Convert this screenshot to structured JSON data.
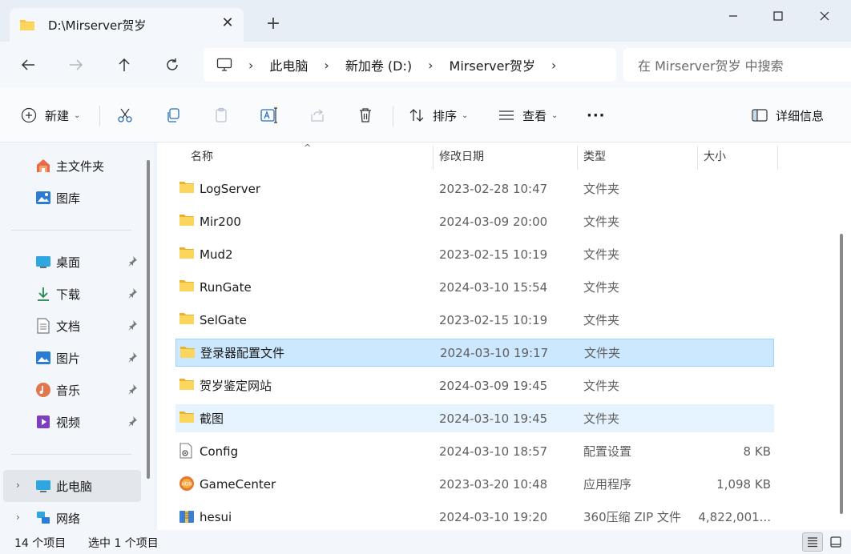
{
  "tab": {
    "title": "D:\\Mirserver贺岁"
  },
  "address": {
    "crumbs": [
      "此电脑",
      "新加卷 (D:)",
      "Mirserver贺岁"
    ],
    "search_placeholder": "在 Mirserver贺岁 中搜索"
  },
  "toolbar": {
    "new_label": "新建",
    "sort_label": "排序",
    "view_label": "查看",
    "more_label": "···",
    "details_label": "详细信息"
  },
  "sidebar": {
    "top": [
      {
        "label": "主文件夹",
        "icon": "home-icon"
      },
      {
        "label": "图库",
        "icon": "gallery-icon"
      }
    ],
    "pinned": [
      {
        "label": "桌面",
        "icon": "desktop-icon"
      },
      {
        "label": "下载",
        "icon": "download-icon"
      },
      {
        "label": "文档",
        "icon": "document-icon"
      },
      {
        "label": "图片",
        "icon": "picture-icon"
      },
      {
        "label": "音乐",
        "icon": "music-icon"
      },
      {
        "label": "视频",
        "icon": "video-icon"
      }
    ],
    "bottom": [
      {
        "label": "此电脑",
        "icon": "pc-icon"
      },
      {
        "label": "网络",
        "icon": "network-icon"
      }
    ]
  },
  "columns": {
    "name": "名称",
    "date": "修改日期",
    "type": "类型",
    "size": "大小"
  },
  "files": [
    {
      "name": "LogServer",
      "date": "2023-02-28 10:47",
      "type": "文件夹",
      "size": "",
      "icon": "folder-icon"
    },
    {
      "name": "Mir200",
      "date": "2024-03-09 20:00",
      "type": "文件夹",
      "size": "",
      "icon": "folder-icon"
    },
    {
      "name": "Mud2",
      "date": "2023-02-15 10:19",
      "type": "文件夹",
      "size": "",
      "icon": "folder-icon"
    },
    {
      "name": "RunGate",
      "date": "2024-03-10 15:54",
      "type": "文件夹",
      "size": "",
      "icon": "folder-icon"
    },
    {
      "name": "SelGate",
      "date": "2023-02-15 10:19",
      "type": "文件夹",
      "size": "",
      "icon": "folder-icon"
    },
    {
      "name": "登录器配置文件",
      "date": "2024-03-10 19:17",
      "type": "文件夹",
      "size": "",
      "icon": "folder-icon"
    },
    {
      "name": "贺岁鉴定网站",
      "date": "2024-03-09 19:45",
      "type": "文件夹",
      "size": "",
      "icon": "folder-icon"
    },
    {
      "name": "截图",
      "date": "2024-03-10 19:45",
      "type": "文件夹",
      "size": "",
      "icon": "folder-icon"
    },
    {
      "name": "Config",
      "date": "2024-03-10 18:57",
      "type": "配置设置",
      "size": "8 KB",
      "icon": "config-file-icon"
    },
    {
      "name": "GameCenter",
      "date": "2023-03-20 10:48",
      "type": "应用程序",
      "size": "1,098 KB",
      "icon": "app-icon"
    },
    {
      "name": "hesui",
      "date": "2024-03-10 19:20",
      "type": "360压缩 ZIP 文件",
      "size": "4,822,001...",
      "icon": "zip-icon"
    }
  ],
  "status": {
    "count": "14 个项目",
    "selected": "选中 1 个项目"
  },
  "colors": {
    "selection": "#cce8ff",
    "hover": "#e5f3ff",
    "folder": "#f8c73b"
  }
}
